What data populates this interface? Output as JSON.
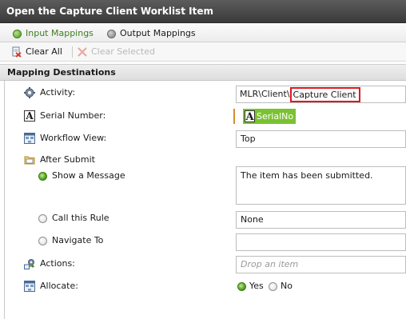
{
  "window": {
    "title": "Open the Capture Client Worklist Item"
  },
  "tabs": [
    {
      "label": "Input Mappings",
      "active": true,
      "icon": "green-dot-icon"
    },
    {
      "label": "Output Mappings",
      "active": false,
      "icon": "gray-dot-icon"
    }
  ],
  "toolbar": {
    "clear_all_label": "Clear All",
    "clear_selected_label": "Clear Selected"
  },
  "section": {
    "title": "Mapping Destinations"
  },
  "rows": {
    "activity": {
      "label": "Activity:",
      "value_prefix": "MLR\\Client\\",
      "value_highlight": "Capture Client",
      "icon": "gear-icon"
    },
    "serial_number": {
      "label": "Serial Number:",
      "token": "SerialNo",
      "icon": "text-a-icon"
    },
    "workflow_view": {
      "label": "Workflow View:",
      "value": "Top",
      "icon": "workflow-view-icon"
    },
    "after_submit": {
      "label": "After Submit",
      "icon": "folder-icon"
    },
    "show_message": {
      "label": "Show a Message",
      "value": "The item has been submitted.",
      "selected": true
    },
    "call_rule": {
      "label": "Call this Rule",
      "value": "None",
      "selected": false
    },
    "navigate_to": {
      "label": "Navigate To",
      "value": "",
      "selected": false
    },
    "actions": {
      "label": "Actions:",
      "placeholder": "Drop an item",
      "icon": "actions-icon"
    },
    "allocate": {
      "label": "Allocate:",
      "icon": "workflow-view-icon",
      "options": [
        {
          "label": "Yes",
          "selected": true
        },
        {
          "label": "No",
          "selected": false
        }
      ]
    }
  },
  "colors": {
    "accent_green": "#7bc232",
    "highlight_red": "#e2171f",
    "title_bg": "#444444"
  }
}
